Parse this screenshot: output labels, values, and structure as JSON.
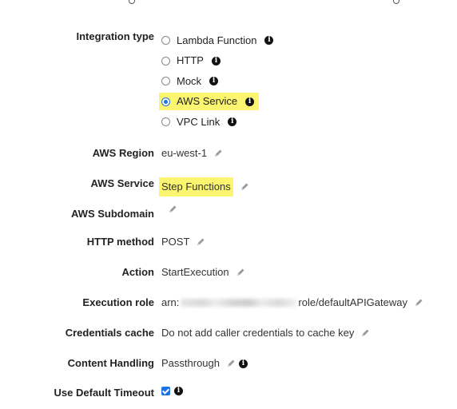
{
  "integration_type": {
    "label": "Integration type",
    "options": [
      {
        "label": "Lambda Function",
        "checked": false,
        "highlighted": false
      },
      {
        "label": "HTTP",
        "checked": false,
        "highlighted": false
      },
      {
        "label": "Mock",
        "checked": false,
        "highlighted": false
      },
      {
        "label": "AWS Service",
        "checked": true,
        "highlighted": true
      },
      {
        "label": "VPC Link",
        "checked": false,
        "highlighted": false
      }
    ]
  },
  "fields": {
    "aws_region": {
      "label": "AWS Region",
      "value": "eu-west-1"
    },
    "aws_service": {
      "label": "AWS Service",
      "value": "Step Functions"
    },
    "aws_subdomain": {
      "label": "AWS Subdomain",
      "value": ""
    },
    "http_method": {
      "label": "HTTP method",
      "value": "POST"
    },
    "action": {
      "label": "Action",
      "value": "StartExecution"
    },
    "execution_role": {
      "label": "Execution role",
      "prefix": "arn:",
      "suffix": "role/defaultAPIGateway"
    },
    "credentials_cache": {
      "label": "Credentials cache",
      "value": "Do not add caller credentials to cache key"
    },
    "content_handling": {
      "label": "Content Handling",
      "value": "Passthrough"
    },
    "use_default_timeout": {
      "label": "Use Default Timeout",
      "checked": true
    }
  },
  "icons": {
    "info": "i"
  },
  "colors": {
    "highlight": "#fbf56f",
    "accent": "#1a73e8"
  }
}
